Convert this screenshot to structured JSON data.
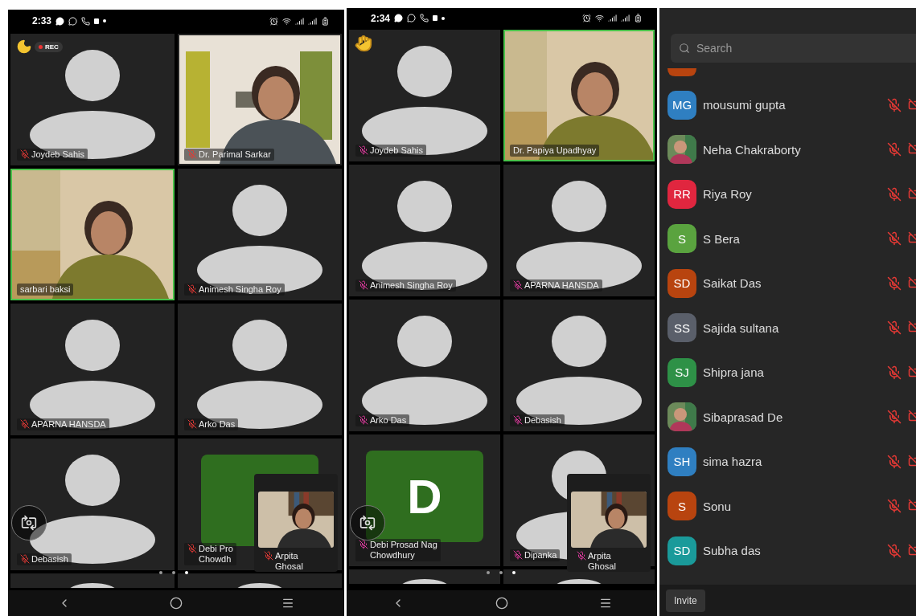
{
  "phones": [
    {
      "time": "2:33",
      "badge": {
        "kind": "rec",
        "label": "REC"
      },
      "tiles": [
        {
          "kind": "avatar",
          "name": "Joydeb Sahis",
          "muted": true,
          "active": false
        },
        {
          "kind": "video",
          "name": "Dr. Parimal Sarkar",
          "muted": true,
          "active": false
        },
        {
          "kind": "video",
          "name": "sarbari baksi",
          "muted": false,
          "active": true
        },
        {
          "kind": "avatar",
          "name": "Animesh Singha Roy",
          "muted": true,
          "active": false
        },
        {
          "kind": "avatar",
          "name": "APARNA HANSDA",
          "muted": true,
          "active": false
        },
        {
          "kind": "avatar",
          "name": "Arko Das",
          "muted": true,
          "active": false
        },
        {
          "kind": "avatar",
          "name": "Debasish",
          "muted": true,
          "active": false
        },
        {
          "kind": "letter",
          "name": "Debi Pro\nChowdh",
          "muted": true,
          "active": false
        }
      ],
      "pip": {
        "name": "Arpita\nGhosal",
        "muted": true
      },
      "pages": [
        {
          "selected": false
        },
        {
          "selected": false
        },
        {
          "selected": true
        }
      ]
    },
    {
      "time": "2:34",
      "badge": {
        "kind": "hand"
      },
      "tiles": [
        {
          "kind": "avatar",
          "name": "Joydeb Sahis",
          "muted": true,
          "active": false
        },
        {
          "kind": "video",
          "name": "Dr. Papiya Upadhyay",
          "muted": false,
          "active": true
        },
        {
          "kind": "avatar",
          "name": "Animesh Singha Roy",
          "muted": true,
          "active": false
        },
        {
          "kind": "avatar",
          "name": "APARNA HANSDA",
          "muted": true,
          "active": false
        },
        {
          "kind": "avatar",
          "name": "Arko Das",
          "muted": true,
          "active": false
        },
        {
          "kind": "avatar",
          "name": "Debasish",
          "muted": true,
          "active": false
        },
        {
          "kind": "letter",
          "letter": "D",
          "name": "Debi Prosad Nag\nChowdhury",
          "muted": true,
          "active": false
        },
        {
          "kind": "avatar",
          "name": "Dipanka",
          "muted": true,
          "active": false
        }
      ],
      "pip": {
        "name": "Arpita\nGhosal",
        "muted": true
      },
      "pages": [
        {
          "selected": false
        },
        {
          "selected": false
        },
        {
          "selected": true
        }
      ]
    }
  ],
  "participants": {
    "search": {
      "placeholder": "Search"
    },
    "rows": [
      {
        "kind": "initials",
        "initials": "MG",
        "color": "#2f7fc1",
        "name": "mousumi gupta",
        "muted": true,
        "video_off": true
      },
      {
        "name": "Neha Chakraborty",
        "muted": true,
        "video_off": true
      },
      {
        "kind": "initials",
        "initials": "RR",
        "color": "#e0263f",
        "name": "Riya Roy",
        "muted": true,
        "video_off": true
      },
      {
        "kind": "initials",
        "initials": "S",
        "color": "#5aa33f",
        "name": "S Bera",
        "muted": true,
        "video_off": true
      },
      {
        "kind": "initials",
        "initials": "SD",
        "color": "#b8440f",
        "name": "Saikat Das",
        "muted": true,
        "video_off": true
      },
      {
        "kind": "initials",
        "initials": "SS",
        "color": "#5a5f6a",
        "name": "Sajida sultana",
        "muted": true,
        "video_off": true
      },
      {
        "kind": "initials",
        "initials": "SJ",
        "color": "#2e9147",
        "name": "Shipra jana",
        "muted": true,
        "video_off": true
      },
      {
        "name": "Sibaprasad De",
        "muted": true,
        "video_off": true
      },
      {
        "kind": "initials",
        "initials": "SH",
        "color": "#2f7fc1",
        "name": "sima hazra",
        "muted": true,
        "video_off": true
      },
      {
        "kind": "initials",
        "initials": "S",
        "color": "#b8440f",
        "name": "Sonu",
        "muted": true,
        "video_off": true
      },
      {
        "kind": "initials",
        "initials": "SD",
        "color": "#1a9a9a",
        "name": "Subha das",
        "muted": true,
        "video_off": true
      }
    ],
    "invite": "Invite"
  }
}
